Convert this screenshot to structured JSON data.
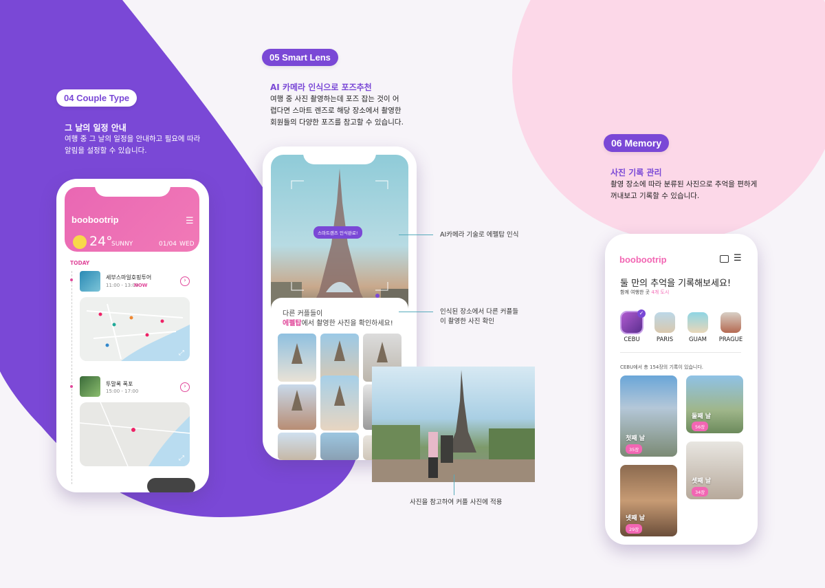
{
  "sections": {
    "couple_type": {
      "pill": "04 Couple Type",
      "title": "그 날의 일정 안내",
      "desc": "여행 중 그 날의 일정을 안내하고 필요에 따라\n알림을 설정할 수 있습니다."
    },
    "smart_lens": {
      "pill": "05 Smart Lens",
      "title": "AI 카메라 인식으로 포즈추천",
      "desc": "여행 중 사진 촬영하는데 포즈 잡는 것이 어\n렵다면 스마트 렌즈로 해당 장소에서 촬영한\n회원들의 다양한 포즈를 참고할 수 있습니다."
    },
    "memory": {
      "pill": "06 Memory",
      "title": "사진 기록 관리",
      "desc": "촬영 장소에 따라 분류된 사진으로 추억을 편하게\n꺼내보고 기록할 수 있습니다."
    }
  },
  "phone1": {
    "brand": "boobootrip",
    "temp": "24°",
    "weather": "SUNNY",
    "date": "01/04",
    "weekday": "WED",
    "today": "TODAY",
    "events": [
      {
        "title": "세부스마일호핑투어",
        "time": "11:00 - 13:00",
        "now": "NOW"
      },
      {
        "title": "투말록 폭포",
        "time": "15:00 - 17:00"
      }
    ]
  },
  "phone2": {
    "lens_badge": "스마트렌즈 인식완료!",
    "panel_line1": "다른 커플들이",
    "panel_highlight": "에펠탑",
    "panel_line2_rest": "에서 촬영한 사진을 확인하세요!"
  },
  "annotations": {
    "ai_recognize": "AI카메라 기술로 에펠탑 인식",
    "others_photos": "인식된 장소에서 다른 커플들\n이 촬영한 사진 확인",
    "apply_photo": "사진을 참고하여 커플 사진에 적용"
  },
  "phone3": {
    "brand": "boobootrip",
    "headline": "둘 만의 추억을 기록해보세요!",
    "sub_prefix": "함께 여행한 곳",
    "sub_count": "4개 도시",
    "cities": [
      "CEBU",
      "PARIS",
      "GUAM",
      "PRAGUE"
    ],
    "record_info": "CEBU에서 총 154장의 기록이 있습니다.",
    "memories": [
      {
        "label": "첫째 날",
        "count": "35장"
      },
      {
        "label": "둘째 날",
        "count": "56장"
      },
      {
        "label": "셋째 날",
        "count": "34장"
      },
      {
        "label": "넷째 날",
        "count": "29장"
      }
    ]
  },
  "colors": {
    "purple": "#7a48d6",
    "pink": "#f266b3",
    "light_pink": "#fcd8e8"
  }
}
